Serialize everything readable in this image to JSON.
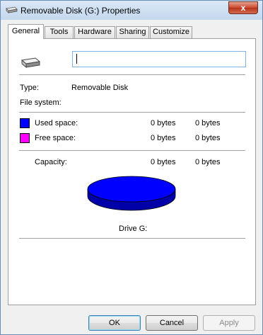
{
  "window": {
    "title": "Removable Disk (G:) Properties",
    "close_glyph": "x"
  },
  "tabs": [
    {
      "label": "General",
      "active": true
    },
    {
      "label": "Tools"
    },
    {
      "label": "Hardware"
    },
    {
      "label": "Sharing"
    },
    {
      "label": "Customize"
    }
  ],
  "general": {
    "drive_icon": "removable-drive-icon",
    "name_value": "",
    "type_label": "Type:",
    "type_value": "Removable Disk",
    "fs_label": "File system:",
    "fs_value": "",
    "used_label": "Used space:",
    "used_bytes": "0 bytes",
    "used_size": "0 bytes",
    "used_color": "#0000ff",
    "free_label": "Free space:",
    "free_bytes": "0 bytes",
    "free_size": "0 bytes",
    "free_color": "#ff00ff",
    "capacity_label": "Capacity:",
    "capacity_bytes": "0 bytes",
    "capacity_size": "0 bytes",
    "drive_label": "Drive G:",
    "used_fraction": 1.0
  },
  "buttons": {
    "ok": "OK",
    "cancel": "Cancel",
    "apply": "Apply"
  }
}
